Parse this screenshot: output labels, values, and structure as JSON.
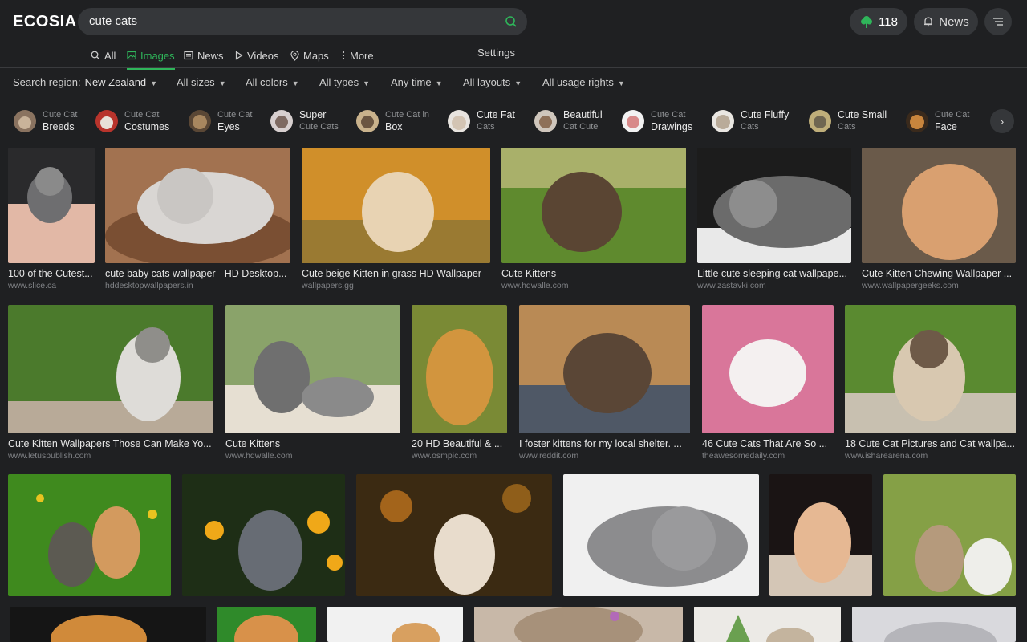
{
  "header": {
    "logo": "ECOSIA",
    "search_value": "cute cats",
    "tree_count": "118",
    "news_label": "News"
  },
  "tabs": [
    {
      "label": "All",
      "icon": "search-icon"
    },
    {
      "label": "Images",
      "icon": "image-icon",
      "active": true
    },
    {
      "label": "News",
      "icon": "newspaper-icon"
    },
    {
      "label": "Videos",
      "icon": "play-icon"
    },
    {
      "label": "Maps",
      "icon": "map-pin-icon"
    },
    {
      "label": "More",
      "icon": "more-vertical-icon"
    }
  ],
  "settings_label": "Settings",
  "filters": {
    "region_label": "Search region:",
    "region_value": "New Zealand",
    "sizes": "All sizes",
    "colors": "All colors",
    "types": "All types",
    "time": "Any time",
    "layouts": "All layouts",
    "rights": "All usage rights"
  },
  "related": [
    {
      "l1": "Cute Cat",
      "l2": "Breeds"
    },
    {
      "l1": "Cute Cat",
      "l2": "Costumes"
    },
    {
      "l1": "Cute Cat",
      "l2": "Eyes"
    },
    {
      "l1": "Super",
      "l2": "Cute Cats"
    },
    {
      "l1": "Cute Cat in",
      "l2": "Box"
    },
    {
      "l1": "Cute Fat",
      "l2": "Cats"
    },
    {
      "l1": "Beautiful",
      "l2": "Cat Cute"
    },
    {
      "l1": "Cute Cat",
      "l2": "Drawings"
    },
    {
      "l1": "Cute Fluffy",
      "l2": "Cats"
    },
    {
      "l1": "Cute Small",
      "l2": "Cats"
    },
    {
      "l1": "Cute Cat",
      "l2": "Face"
    }
  ],
  "results": [
    {
      "title": "100 of the Cutest...",
      "source": "www.slice.ca"
    },
    {
      "title": "cute baby cats wallpaper - HD Desktop...",
      "source": "hddesktopwallpapers.in"
    },
    {
      "title": "Cute beige Kitten in grass HD Wallpaper",
      "source": "wallpapers.gg"
    },
    {
      "title": "Cute Kittens",
      "source": "www.hdwalle.com"
    },
    {
      "title": "Little cute sleeping cat wallpape...",
      "source": "www.zastavki.com"
    },
    {
      "title": "Cute Kitten Chewing Wallpaper ...",
      "source": "www.wallpapergeeks.com"
    },
    {
      "title": "Cute Kitten Wallpapers Those Can Make Yo...",
      "source": "www.letuspublish.com"
    },
    {
      "title": "Cute Kittens",
      "source": "www.hdwalle.com"
    },
    {
      "title": "20 HD Beautiful & ...",
      "source": "www.osmpic.com"
    },
    {
      "title": "I foster kittens for my local shelter. ...",
      "source": "www.reddit.com"
    },
    {
      "title": "46 Cute Cats That Are So ...",
      "source": "theawesomedaily.com"
    },
    {
      "title": "18 Cute Cat Pictures and Cat wallpa...",
      "source": "www.isharearena.com"
    }
  ],
  "palette": {
    "background": "#1f2022",
    "accent_green": "#2fb55a",
    "chip_bg": "#35373a"
  }
}
